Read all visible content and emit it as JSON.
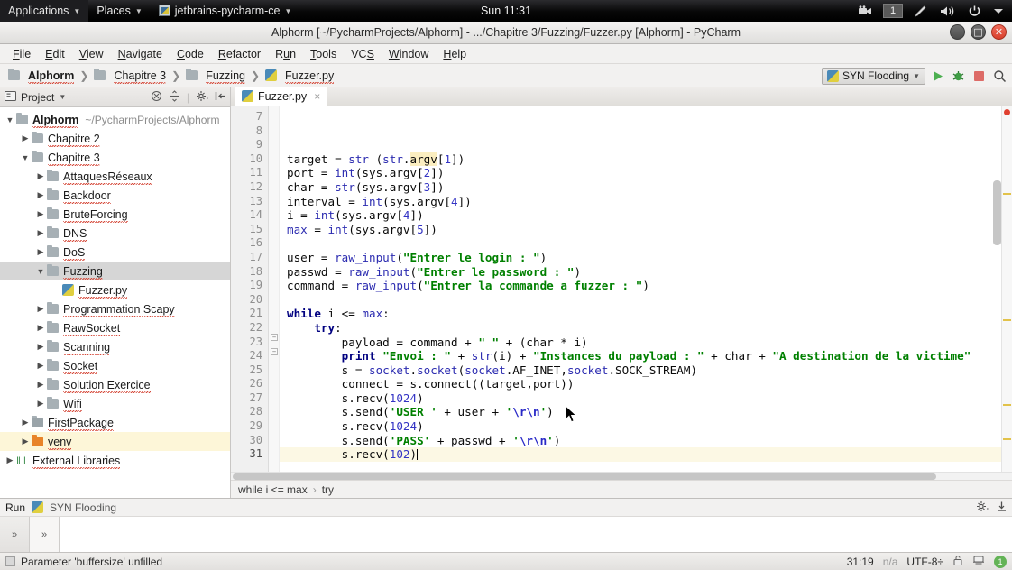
{
  "desktop": {
    "applications_label": "Applications",
    "places_label": "Places",
    "window_menu_label": "jetbrains-pycharm-ce",
    "clock": "Sun 11:31",
    "workspace": "1",
    "tray_icons": [
      "camera-icon",
      "workspace-indicator",
      "pen-icon",
      "volume-icon",
      "power-icon",
      "chevron-down-icon"
    ]
  },
  "window": {
    "title": "Alphorm [~/PycharmProjects/Alphorm] - .../Chapitre 3/Fuzzing/Fuzzer.py [Alphorm] - PyCharm",
    "minimize_glyph": "−",
    "maximize_glyph": "□",
    "close_glyph": "✕"
  },
  "menubar": [
    {
      "label": "File",
      "mnemonic": "F"
    },
    {
      "label": "Edit",
      "mnemonic": "E"
    },
    {
      "label": "View",
      "mnemonic": "V"
    },
    {
      "label": "Navigate",
      "mnemonic": "N"
    },
    {
      "label": "Code",
      "mnemonic": "C"
    },
    {
      "label": "Refactor",
      "mnemonic": "R"
    },
    {
      "label": "Run",
      "mnemonic": "u"
    },
    {
      "label": "Tools",
      "mnemonic": "T"
    },
    {
      "label": "VCS",
      "mnemonic": "S"
    },
    {
      "label": "Window",
      "mnemonic": "W"
    },
    {
      "label": "Help",
      "mnemonic": "H"
    }
  ],
  "navbar": {
    "crumbs": [
      {
        "label": "Alphorm",
        "icon": "folder-icon",
        "bold": true
      },
      {
        "label": "Chapitre 3",
        "icon": "folder-icon",
        "bold": false
      },
      {
        "label": "Fuzzing",
        "icon": "folder-icon",
        "bold": false
      },
      {
        "label": "Fuzzer.py",
        "icon": "python-file-icon",
        "bold": false
      }
    ],
    "run_config": "SYN Flooding",
    "buttons": [
      "run-icon",
      "debug-icon",
      "stop-icon",
      "search-icon"
    ]
  },
  "project_panel": {
    "title": "Project",
    "header_icons": [
      "collapse-all-icon",
      "expand-all-icon",
      "settings-icon",
      "hide-icon"
    ],
    "root": {
      "name": "Alphorm",
      "path": "~/PycharmProjects/Alphorm"
    },
    "tree": [
      {
        "label": "Alphorm",
        "path": "~/PycharmProjects/Alphorm",
        "depth": 0,
        "arrow": "down",
        "icon": "folder",
        "bold": true,
        "state": "none"
      },
      {
        "label": "Chapitre 2",
        "depth": 1,
        "arrow": "right",
        "icon": "folder",
        "state": "none"
      },
      {
        "label": "Chapitre 3",
        "depth": 1,
        "arrow": "down",
        "icon": "folder",
        "state": "none"
      },
      {
        "label": "AttaquesRéseaux",
        "depth": 2,
        "arrow": "right",
        "icon": "folder",
        "state": "none"
      },
      {
        "label": "Backdoor",
        "depth": 2,
        "arrow": "right",
        "icon": "folder",
        "state": "none"
      },
      {
        "label": "BruteForcing",
        "depth": 2,
        "arrow": "right",
        "icon": "folder",
        "state": "none"
      },
      {
        "label": "DNS",
        "depth": 2,
        "arrow": "right",
        "icon": "folder",
        "state": "none"
      },
      {
        "label": "DoS",
        "depth": 2,
        "arrow": "right",
        "icon": "folder",
        "state": "none"
      },
      {
        "label": "Fuzzing",
        "depth": 2,
        "arrow": "down",
        "icon": "folder",
        "state": "selected"
      },
      {
        "label": "Fuzzer.py",
        "depth": 3,
        "arrow": "none",
        "icon": "python",
        "state": "none"
      },
      {
        "label": "Programmation Scapy",
        "depth": 2,
        "arrow": "right",
        "icon": "folder",
        "state": "none"
      },
      {
        "label": "RawSocket",
        "depth": 2,
        "arrow": "right",
        "icon": "folder",
        "state": "none"
      },
      {
        "label": "Scanning",
        "depth": 2,
        "arrow": "right",
        "icon": "folder",
        "state": "none"
      },
      {
        "label": "Socket",
        "depth": 2,
        "arrow": "right",
        "icon": "folder",
        "state": "none"
      },
      {
        "label": "Solution Exercice",
        "depth": 2,
        "arrow": "right",
        "icon": "folder",
        "state": "none"
      },
      {
        "label": "Wifi",
        "depth": 2,
        "arrow": "right",
        "icon": "folder",
        "state": "none"
      },
      {
        "label": "FirstPackage",
        "depth": 1,
        "arrow": "right",
        "icon": "package",
        "state": "none"
      },
      {
        "label": "venv",
        "depth": 1,
        "arrow": "right",
        "icon": "folder-orange",
        "state": "highlight"
      },
      {
        "label": "External Libraries",
        "depth": 0,
        "arrow": "right",
        "icon": "library",
        "state": "none"
      }
    ]
  },
  "editor": {
    "tab": {
      "label": "Fuzzer.py",
      "icon": "python-file-icon",
      "close_glyph": "×"
    },
    "first_visible_line": 7,
    "current_line": 31,
    "breadcrumb": [
      "while i <= max",
      "try"
    ],
    "lines": [
      {
        "n": 7,
        "text": ""
      },
      {
        "n": 8,
        "text": ""
      },
      {
        "n": 9,
        "text": ""
      },
      {
        "n": 10,
        "text": "target = str (str.argv[1])"
      },
      {
        "n": 11,
        "text": "port = int(sys.argv[2])"
      },
      {
        "n": 12,
        "text": "char = str(sys.argv[3])"
      },
      {
        "n": 13,
        "text": "interval = int(sys.argv[4])"
      },
      {
        "n": 14,
        "text": "i = int(sys.argv[4])"
      },
      {
        "n": 15,
        "text": "max = int(sys.argv[5])"
      },
      {
        "n": 16,
        "text": ""
      },
      {
        "n": 17,
        "text": "user = raw_input(\"Entrer le login : \")"
      },
      {
        "n": 18,
        "text": "passwd = raw_input(\"Entrer le password : \")"
      },
      {
        "n": 19,
        "text": "command = raw_input(\"Entrer la commande a fuzzer : \")"
      },
      {
        "n": 20,
        "text": ""
      },
      {
        "n": 21,
        "text": "while i <= max:"
      },
      {
        "n": 22,
        "text": "    try:"
      },
      {
        "n": 23,
        "text": "        payload = command + \" \" + (char * i)"
      },
      {
        "n": 24,
        "text": "        print \"Envoi : \" + str(i) + \"Instances du payload : \" + char + \"A destination de la victime\""
      },
      {
        "n": 25,
        "text": "        s = socket.socket(socket.AF_INET,socket.SOCK_STREAM)"
      },
      {
        "n": 26,
        "text": "        connect = s.connect((target,port))"
      },
      {
        "n": 27,
        "text": "        s.recv(1024)"
      },
      {
        "n": 28,
        "text": "        s.send('USER ' + user + '\\r\\n')"
      },
      {
        "n": 29,
        "text": "        s.recv(1024)"
      },
      {
        "n": 30,
        "text": "        s.send('PASS' + passwd + '\\r\\n')"
      },
      {
        "n": 31,
        "text": "        s.recv(102)"
      }
    ]
  },
  "run_panel": {
    "label": "Run",
    "config_name": "SYN Flooding",
    "tabs": [
      "»",
      "»"
    ],
    "right_icons": [
      "settings-icon",
      "hide-icon"
    ]
  },
  "statusbar": {
    "message": "Parameter 'buffersize' unfilled",
    "caret_position": "31:19",
    "line_separator": "n/a",
    "encoding": "UTF-8÷",
    "lock_icon": "read-only-lock-icon",
    "inspection_icon": "inspection-icon",
    "event_count": "1"
  },
  "colors": {
    "keyword": "#000080",
    "string": "#008000",
    "number": "#3333c4",
    "builtin": "#2b2bb0",
    "accent_run": "#4caf50",
    "accent_error": "#e04030",
    "venv_folder": "#e8842a"
  }
}
